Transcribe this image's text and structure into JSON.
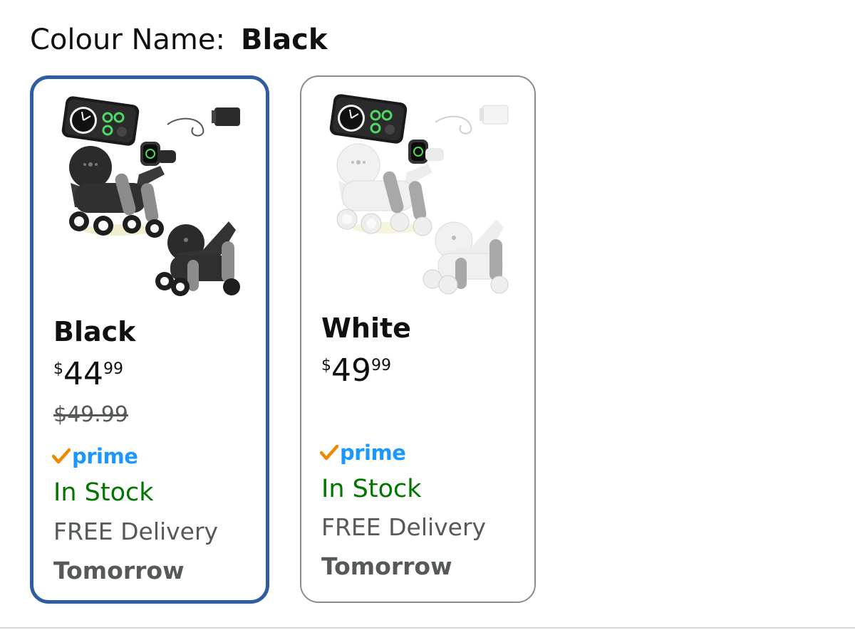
{
  "colour": {
    "label": "Colour Name:",
    "value": "Black"
  },
  "swatches": [
    {
      "name": "Black",
      "price_symbol": "$",
      "price_whole": "44",
      "price_fraction": "99",
      "was_price": "$49.99",
      "prime_label": "prime",
      "stock": "In Stock",
      "delivery": "FREE Delivery",
      "delivery_when": "Tomorrow",
      "selected": true,
      "image": "black-robot-dog-charging-dock-image"
    },
    {
      "name": "White",
      "price_symbol": "$",
      "price_whole": "49",
      "price_fraction": "99",
      "prime_label": "prime",
      "stock": "In Stock",
      "delivery": "FREE Delivery",
      "delivery_when": "Tomorrow",
      "selected": false,
      "image": "white-robot-dog-charging-dock-image"
    }
  ],
  "colors": {
    "selected_border": "#2f5d9f",
    "unselected_border": "#8c8c8c",
    "in_stock": "#007600",
    "prime_blue": "#1a98ff",
    "prime_check": "#f08804",
    "muted_text": "#565959"
  }
}
